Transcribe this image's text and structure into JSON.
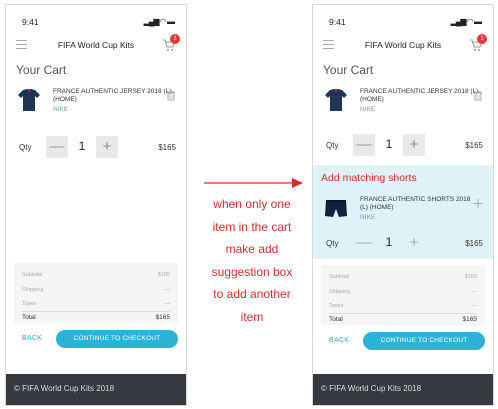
{
  "status_bar": {
    "time": "9:41",
    "indicators": "▂▄▆ ◠ ▬"
  },
  "app": {
    "title": "FIFA World Cup Kits",
    "cart_count": "1"
  },
  "cart": {
    "title": "Your Cart",
    "qty_label": "Qty",
    "minus": "—",
    "plus": "+",
    "items": [
      {
        "name": "FRANCE AUTHENTIC JERSEY 2018 (L) (HOME)",
        "brand": "NIKE",
        "qty": "1",
        "price": "$165"
      }
    ]
  },
  "suggestion": {
    "title": "Add matching shorts",
    "item": {
      "name": "FRANCE AUTHENTIC SHORTS 2018 (L) (HOME)",
      "brand": "NIKE",
      "qty": "1",
      "price": "$165"
    }
  },
  "summary": {
    "subtotal_label": "Subtotal",
    "subtotal_value": "$165",
    "shipping_label": "Shipping",
    "shipping_value": "—",
    "taxes_label": "Taxes",
    "taxes_value": "—",
    "total_label": "Total",
    "total_value": "$165"
  },
  "actions": {
    "back": "BACK",
    "checkout": "CONTINUE TO CHECKOUT"
  },
  "footer": {
    "text": "© FIFA World Cup Kits 2018"
  },
  "annotation": {
    "lines": [
      "when only one",
      "item in the cart",
      "make add",
      "suggestion box",
      "to add another",
      "item"
    ]
  },
  "colors": {
    "accent": "#2bb4d6",
    "annotation": "#d32f2f",
    "footer": "#343a40",
    "suggestion_bg": "#def2f7"
  }
}
